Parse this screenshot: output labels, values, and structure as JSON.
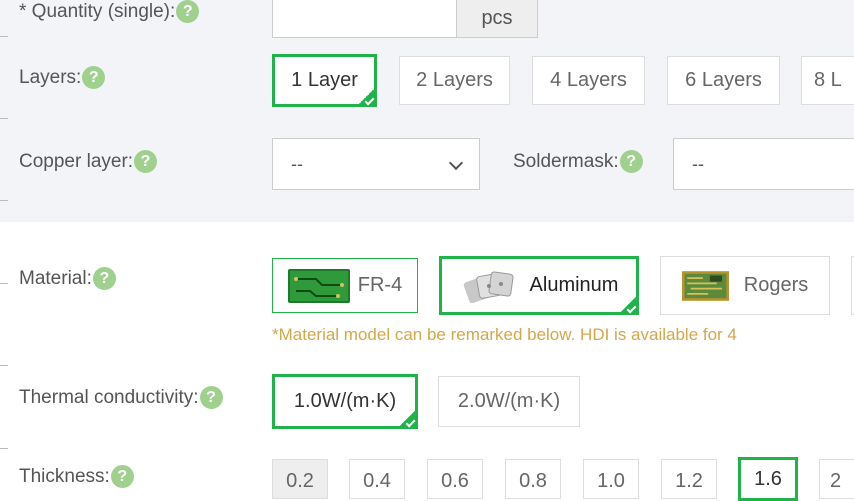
{
  "quantity": {
    "label": "* Quantity (single):",
    "value": "",
    "unit": "pcs"
  },
  "layers": {
    "label": "Layers:",
    "options": [
      "1 Layer",
      "2 Layers",
      "4 Layers",
      "6 Layers",
      "8 L"
    ],
    "selected": "1 Layer"
  },
  "copper": {
    "label": "Copper layer:",
    "value": "--"
  },
  "soldermask": {
    "label": "Soldermask:",
    "value": "--"
  },
  "material": {
    "label": "Material:",
    "options": [
      "FR-4",
      "Aluminum",
      "Rogers"
    ],
    "selected": "Aluminum",
    "note": "*Material model can be remarked below. HDI is available for 4"
  },
  "thermal": {
    "label": "Thermal conductivity:",
    "options": [
      "1.0W/(m·K)",
      "2.0W/(m·K)"
    ],
    "selected": "1.0W/(m·K)"
  },
  "thickness": {
    "label": "Thickness:",
    "options": [
      "0.2",
      "0.4",
      "0.6",
      "0.8",
      "1.0",
      "1.2",
      "1.6",
      "2"
    ],
    "selected": "1.6"
  },
  "help_glyph": "?",
  "colors": {
    "accent": "#1fb34a",
    "help": "#9fd08e",
    "note": "#d4a74a",
    "section_bg": "#f3f4f8"
  }
}
